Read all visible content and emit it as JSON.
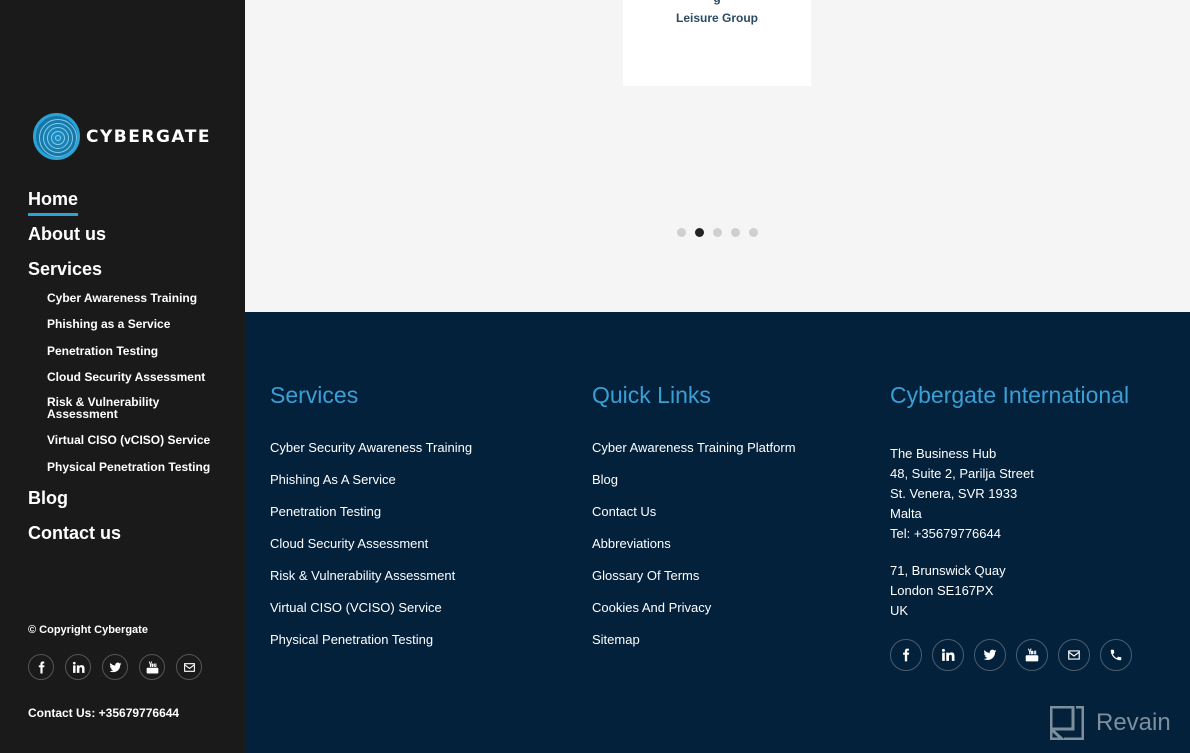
{
  "sidebar": {
    "logo_text": "CYBERGATE",
    "nav": {
      "home": "Home",
      "about": "About us",
      "services": "Services",
      "blog": "Blog",
      "contact": "Contact us"
    },
    "services_sub": [
      "Cyber Awareness Training",
      "Phishing as a Service",
      "Penetration Testing",
      "Cloud Security Assessment",
      "Risk & Vulnerability Assessment",
      "Virtual CISO (vCISO) Service",
      "Physical Penetration Testing"
    ],
    "active_item": "Home",
    "copyright": "© Copyright Cybergate",
    "social_icons": [
      "facebook-icon",
      "linkedin-icon",
      "twitter-icon",
      "youtube-icon",
      "email-icon"
    ],
    "contact_line": "Contact Us: +35679776644"
  },
  "hero": {
    "card_text_partial": "g",
    "card_text": "Leisure Group",
    "carousel": {
      "total_slides": 5,
      "active_index": 1
    }
  },
  "footer": {
    "services": {
      "title": "Services",
      "links": [
        "Cyber Security Awareness Training",
        "Phishing As A Service",
        "Penetration Testing",
        "Cloud Security Assessment",
        "Risk & Vulnerability Assessment",
        "Virtual CISO (VCISO) Service",
        "Physical Penetration Testing"
      ]
    },
    "quick_links": {
      "title": "Quick Links",
      "links": [
        "Cyber Awareness Training Platform",
        "Blog",
        "Contact Us",
        "Abbreviations",
        "Glossary Of Terms",
        "Cookies And Privacy",
        "Sitemap"
      ]
    },
    "international": {
      "title": "Cybergate International",
      "malta": [
        "The Business Hub",
        "48, Suite 2, Parilja Street",
        "St. Venera, SVR 1933",
        "Malta",
        "Tel: +35679776644"
      ],
      "uk": [
        "71, Brunswick Quay",
        "London SE167PX",
        "UK"
      ]
    },
    "social_icons": [
      "facebook-icon",
      "linkedin-icon",
      "twitter-icon",
      "youtube-icon",
      "email-icon",
      "phone-icon"
    ]
  },
  "watermark": {
    "text": "Revain"
  },
  "colors": {
    "sidebar_bg": "#1a1a1a",
    "footer_bg": "#03213b",
    "accent": "#3a9fd6",
    "hero_bg": "#f5f5f5"
  }
}
